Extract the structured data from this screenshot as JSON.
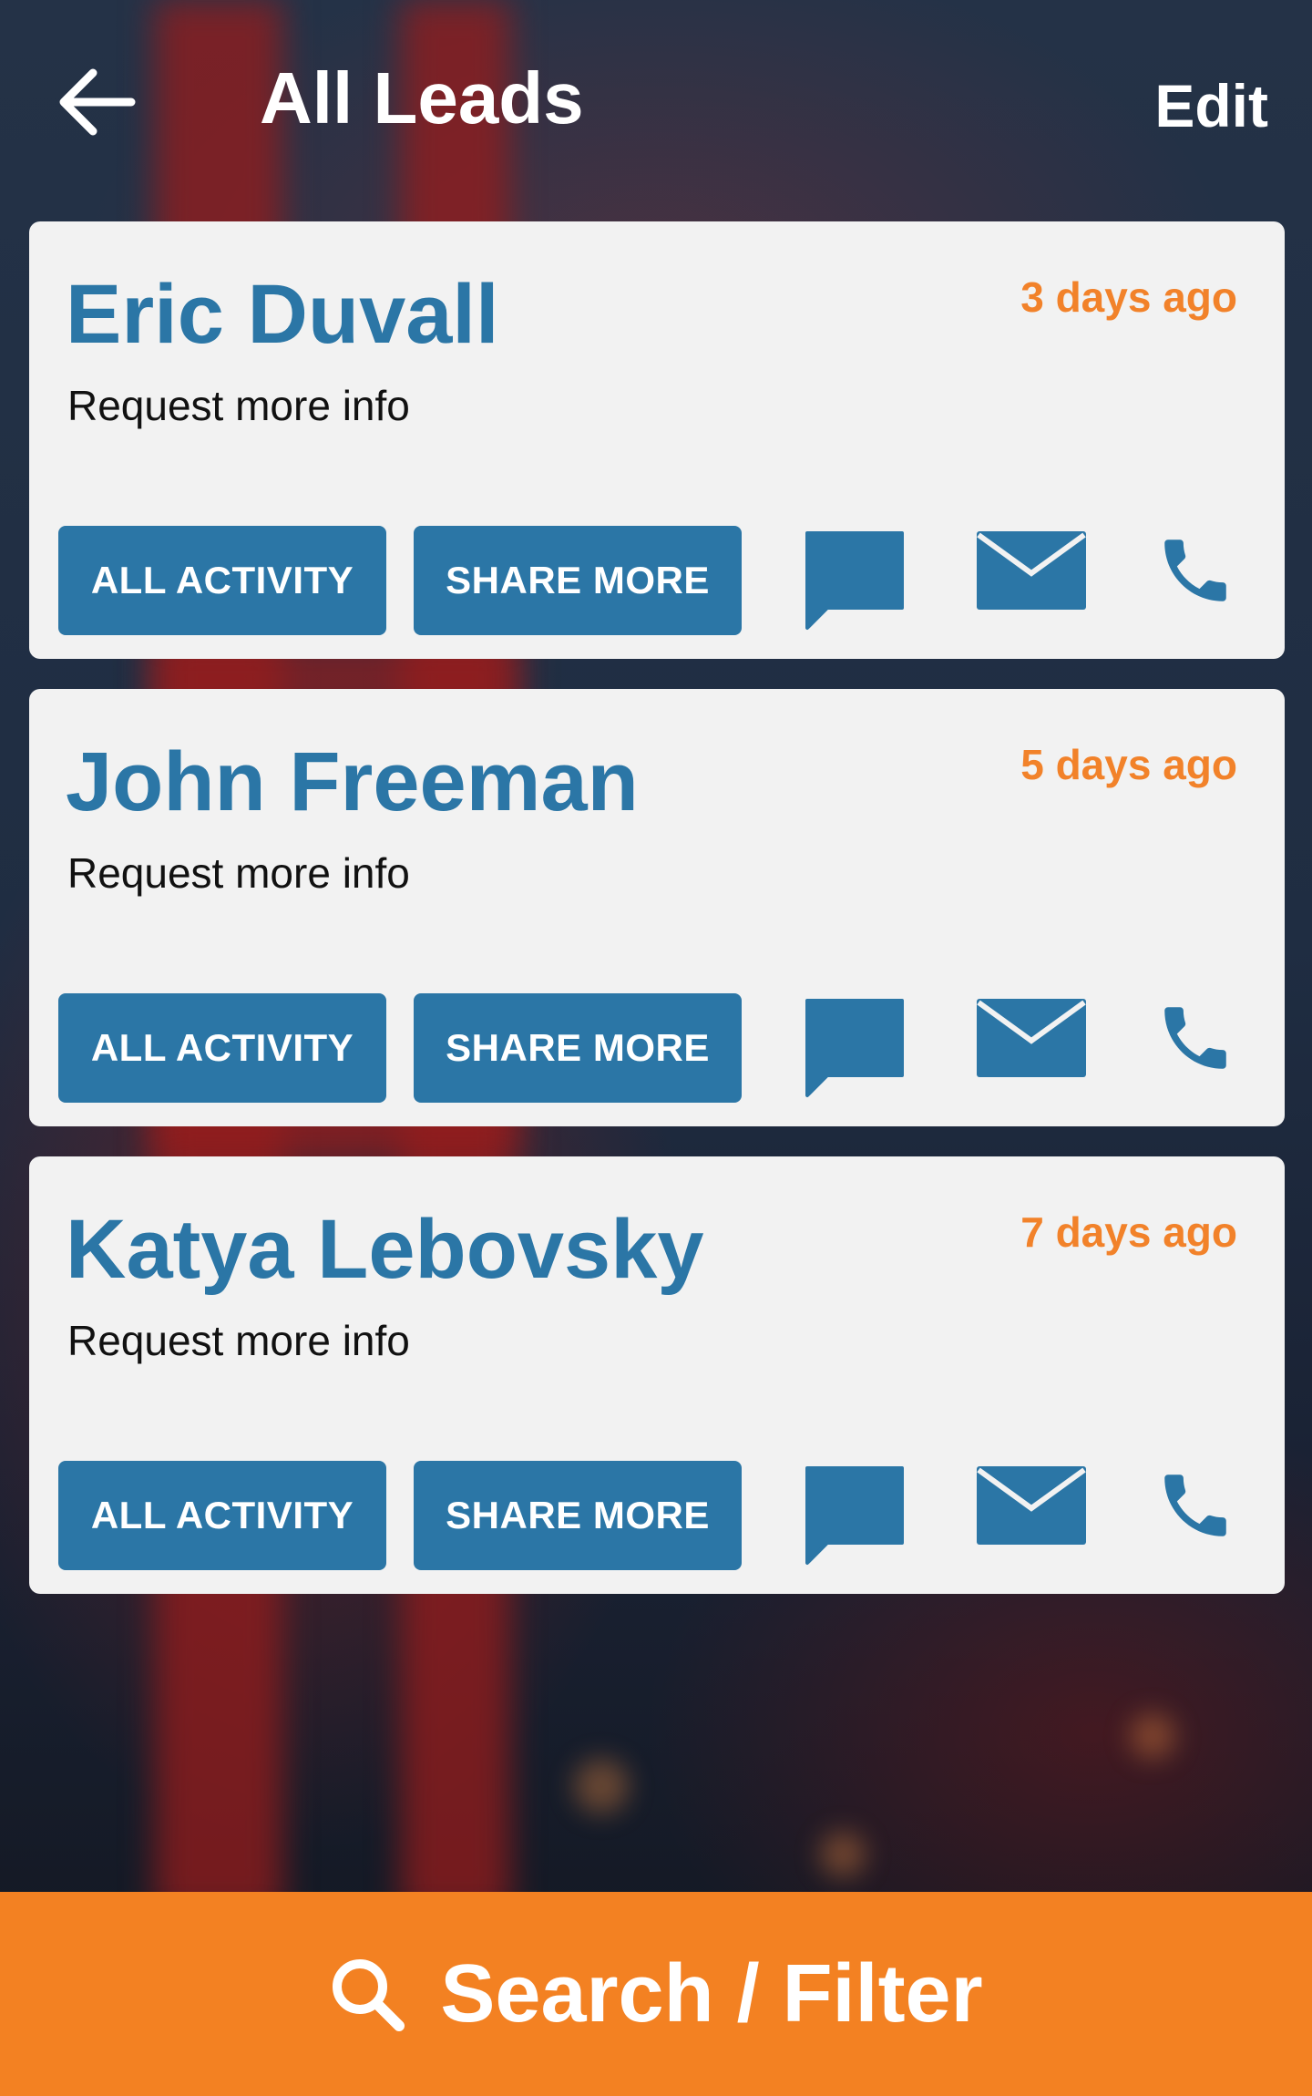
{
  "header": {
    "back_icon": "arrow-left-icon",
    "title": "All Leads",
    "edit_label": "Edit"
  },
  "leads": [
    {
      "name": "Eric Duvall",
      "time": "3 days ago",
      "status": "Request more info"
    },
    {
      "name": "John Freeman",
      "time": "5 days ago",
      "status": "Request more info"
    },
    {
      "name": "Katya Lebovsky",
      "time": "7 days ago",
      "status": "Request more info"
    }
  ],
  "actions": {
    "all_activity": "ALL ACTIVITY",
    "share_more": "SHARE MORE",
    "chat_icon": "chat-bubble-icon",
    "mail_icon": "envelope-icon",
    "phone_icon": "phone-icon"
  },
  "bottom_bar": {
    "icon": "search-icon",
    "label": "Search / Filter"
  },
  "colors": {
    "accent_blue": "#2b76a6",
    "accent_orange": "#f38122",
    "card_bg": "#f2f2f2"
  }
}
